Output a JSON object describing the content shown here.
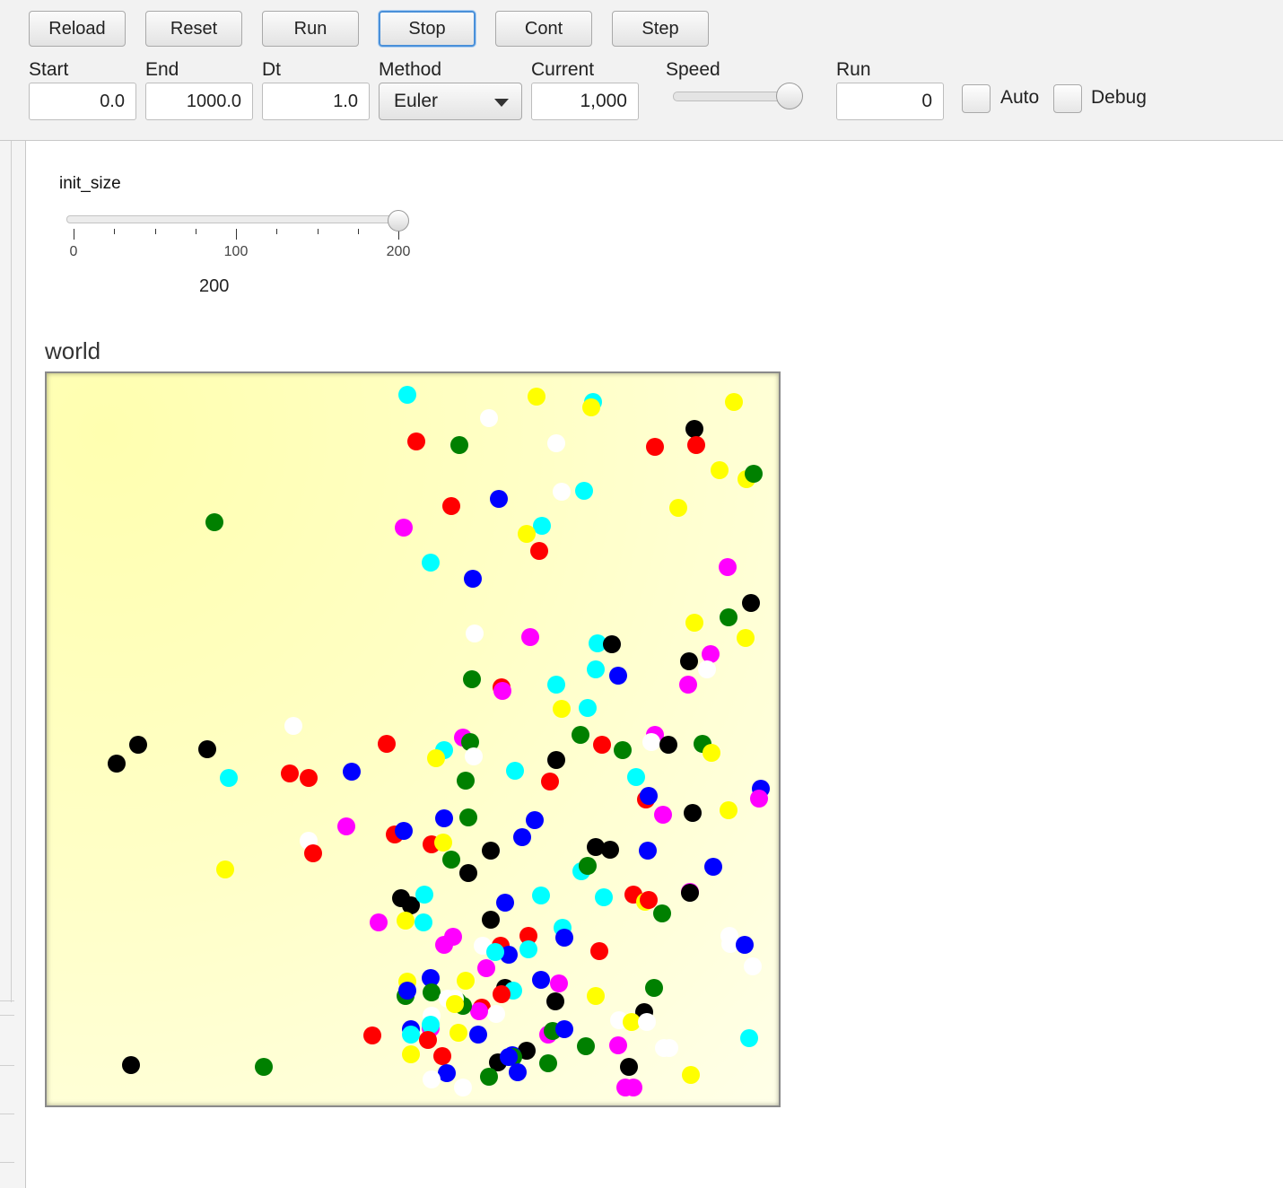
{
  "toolbar": {
    "buttons": [
      "Reload",
      "Reset",
      "Run",
      "Stop",
      "Cont",
      "Step"
    ],
    "labels": {
      "start": "Start",
      "end": "End",
      "dt": "Dt",
      "method": "Method",
      "current": "Current",
      "speed": "Speed",
      "run": "Run"
    },
    "fields": {
      "start": "0.0",
      "end": "1000.0",
      "dt": "1.0",
      "method": "Euler",
      "current": "1,000",
      "run": "0"
    },
    "speed_level": 0.9,
    "checkboxes": {
      "auto": "Auto",
      "debug": "Debug"
    }
  },
  "params": {
    "init_size": {
      "label": "init_size",
      "min": 0,
      "max": 200,
      "value": 200,
      "ticks": [
        "0",
        "100",
        "200"
      ],
      "value_text": "200"
    }
  },
  "world": {
    "title": "world",
    "agent_colors": {
      "c": "#00ffff",
      "y": "#ffff00",
      "w": "#ffffff",
      "r": "#ff0000",
      "g": "#008000",
      "b": "#0000ff",
      "m": "#ff00ff",
      "k": "#000000"
    },
    "agents": [
      [
        "c",
        402,
        24
      ],
      [
        "y",
        546,
        26
      ],
      [
        "c",
        609,
        32
      ],
      [
        "y",
        607,
        38
      ],
      [
        "y",
        766,
        32
      ],
      [
        "w",
        493,
        50
      ],
      [
        "k",
        722,
        62
      ],
      [
        "r",
        412,
        76
      ],
      [
        "g",
        460,
        80
      ],
      [
        "w",
        568,
        78
      ],
      [
        "r",
        678,
        82
      ],
      [
        "r",
        724,
        80
      ],
      [
        "y",
        750,
        108
      ],
      [
        "y",
        780,
        118
      ],
      [
        "g",
        788,
        112
      ],
      [
        "w",
        574,
        132
      ],
      [
        "c",
        599,
        131
      ],
      [
        "b",
        504,
        140
      ],
      [
        "r",
        451,
        148
      ],
      [
        "y",
        704,
        150
      ],
      [
        "g",
        187,
        166
      ],
      [
        "m",
        398,
        172
      ],
      [
        "c",
        552,
        170
      ],
      [
        "y",
        535,
        179
      ],
      [
        "r",
        549,
        198
      ],
      [
        "c",
        428,
        211
      ],
      [
        "b",
        475,
        229
      ],
      [
        "m",
        759,
        216
      ],
      [
        "k",
        785,
        256
      ],
      [
        "g",
        760,
        272
      ],
      [
        "y",
        722,
        278
      ],
      [
        "w",
        477,
        290
      ],
      [
        "m",
        539,
        294
      ],
      [
        "y",
        779,
        295
      ],
      [
        "c",
        614,
        301
      ],
      [
        "k",
        630,
        302
      ],
      [
        "b",
        637,
        337
      ],
      [
        "c",
        612,
        330
      ],
      [
        "m",
        740,
        313
      ],
      [
        "k",
        716,
        321
      ],
      [
        "w",
        736,
        330
      ],
      [
        "g",
        474,
        341
      ],
      [
        "r",
        507,
        350
      ],
      [
        "m",
        508,
        354
      ],
      [
        "c",
        568,
        347
      ],
      [
        "m",
        715,
        347
      ],
      [
        "y",
        574,
        374
      ],
      [
        "c",
        603,
        373
      ],
      [
        "w",
        275,
        393
      ],
      [
        "k",
        102,
        414
      ],
      [
        "k",
        179,
        419
      ],
      [
        "k",
        78,
        435
      ],
      [
        "c",
        203,
        451
      ],
      [
        "r",
        379,
        413
      ],
      [
        "c",
        443,
        420
      ],
      [
        "y",
        434,
        429
      ],
      [
        "m",
        464,
        406
      ],
      [
        "g",
        472,
        411
      ],
      [
        "w",
        476,
        427
      ],
      [
        "g",
        595,
        403
      ],
      [
        "r",
        619,
        414
      ],
      [
        "g",
        642,
        420
      ],
      [
        "m",
        678,
        403
      ],
      [
        "w",
        674,
        411
      ],
      [
        "k",
        693,
        414
      ],
      [
        "g",
        731,
        413
      ],
      [
        "y",
        741,
        423
      ],
      [
        "k",
        568,
        431
      ],
      [
        "c",
        522,
        443
      ],
      [
        "r",
        271,
        446
      ],
      [
        "r",
        292,
        451
      ],
      [
        "b",
        340,
        444
      ],
      [
        "g",
        467,
        454
      ],
      [
        "r",
        561,
        455
      ],
      [
        "c",
        657,
        450
      ],
      [
        "r",
        668,
        475
      ],
      [
        "b",
        671,
        471
      ],
      [
        "m",
        687,
        492
      ],
      [
        "b",
        796,
        463
      ],
      [
        "m",
        794,
        474
      ],
      [
        "k",
        720,
        490
      ],
      [
        "y",
        760,
        487
      ],
      [
        "w",
        292,
        521
      ],
      [
        "m",
        334,
        505
      ],
      [
        "r",
        388,
        514
      ],
      [
        "b",
        398,
        510
      ],
      [
        "r",
        429,
        525
      ],
      [
        "b",
        443,
        496
      ],
      [
        "y",
        442,
        523
      ],
      [
        "g",
        470,
        495
      ],
      [
        "b",
        544,
        498
      ],
      [
        "b",
        530,
        517
      ],
      [
        "k",
        495,
        532
      ],
      [
        "g",
        451,
        542
      ],
      [
        "k",
        470,
        557
      ],
      [
        "k",
        612,
        528
      ],
      [
        "k",
        628,
        531
      ],
      [
        "b",
        670,
        532
      ],
      [
        "c",
        596,
        555
      ],
      [
        "g",
        603,
        549
      ],
      [
        "b",
        743,
        550
      ],
      [
        "r",
        297,
        535
      ],
      [
        "y",
        199,
        553
      ],
      [
        "k",
        395,
        585
      ],
      [
        "k",
        406,
        593
      ],
      [
        "c",
        421,
        581
      ],
      [
        "y",
        400,
        610
      ],
      [
        "m",
        370,
        612
      ],
      [
        "c",
        420,
        612
      ],
      [
        "b",
        511,
        590
      ],
      [
        "c",
        551,
        582
      ],
      [
        "c",
        621,
        584
      ],
      [
        "r",
        654,
        581
      ],
      [
        "y",
        667,
        589
      ],
      [
        "r",
        671,
        587
      ],
      [
        "g",
        686,
        602
      ],
      [
        "m",
        717,
        578
      ],
      [
        "k",
        717,
        579
      ],
      [
        "k",
        495,
        609
      ],
      [
        "w",
        761,
        627
      ],
      [
        "w",
        762,
        636
      ],
      [
        "b",
        778,
        637
      ],
      [
        "w",
        787,
        661
      ],
      [
        "m",
        443,
        637
      ],
      [
        "m",
        453,
        628
      ],
      [
        "r",
        537,
        627
      ],
      [
        "c",
        575,
        618
      ],
      [
        "b",
        577,
        629
      ],
      [
        "c",
        537,
        642
      ],
      [
        "w",
        486,
        638
      ],
      [
        "r",
        506,
        638
      ],
      [
        "b",
        515,
        648
      ],
      [
        "c",
        500,
        645
      ],
      [
        "r",
        616,
        644
      ],
      [
        "m",
        490,
        663
      ],
      [
        "y",
        402,
        678
      ],
      [
        "g",
        400,
        694
      ],
      [
        "b",
        402,
        688
      ],
      [
        "b",
        428,
        674
      ],
      [
        "g",
        429,
        690
      ],
      [
        "y",
        467,
        677
      ],
      [
        "w",
        447,
        697
      ],
      [
        "b",
        551,
        676
      ],
      [
        "m",
        571,
        680
      ],
      [
        "k",
        511,
        685
      ],
      [
        "c",
        520,
        688
      ],
      [
        "r",
        507,
        692
      ],
      [
        "g",
        677,
        685
      ],
      [
        "y",
        612,
        694
      ],
      [
        "k",
        567,
        700
      ],
      [
        "w",
        429,
        716
      ],
      [
        "r",
        485,
        707
      ],
      [
        "w",
        501,
        714
      ],
      [
        "m",
        482,
        711
      ],
      [
        "g",
        464,
        705
      ],
      [
        "g",
        458,
        700
      ],
      [
        "w",
        455,
        697
      ],
      [
        "y",
        455,
        703
      ],
      [
        "k",
        666,
        712
      ],
      [
        "w",
        638,
        721
      ],
      [
        "y",
        652,
        723
      ],
      [
        "w",
        669,
        723
      ],
      [
        "r",
        363,
        738
      ],
      [
        "b",
        406,
        731
      ],
      [
        "m",
        428,
        730
      ],
      [
        "c",
        406,
        737
      ],
      [
        "c",
        428,
        726
      ],
      [
        "r",
        425,
        743
      ],
      [
        "y",
        459,
        735
      ],
      [
        "b",
        481,
        737
      ],
      [
        "m",
        559,
        737
      ],
      [
        "g",
        564,
        733
      ],
      [
        "b",
        577,
        731
      ],
      [
        "w",
        688,
        752
      ],
      [
        "w",
        694,
        752
      ],
      [
        "c",
        783,
        741
      ],
      [
        "y",
        406,
        759
      ],
      [
        "r",
        441,
        761
      ],
      [
        "g",
        601,
        750
      ],
      [
        "m",
        637,
        749
      ],
      [
        "k",
        535,
        755
      ],
      [
        "b",
        519,
        760
      ],
      [
        "g",
        520,
        762
      ],
      [
        "k",
        503,
        768
      ],
      [
        "b",
        515,
        762
      ],
      [
        "g",
        559,
        769
      ],
      [
        "b",
        525,
        779
      ],
      [
        "k",
        649,
        773
      ],
      [
        "y",
        718,
        782
      ],
      [
        "g",
        493,
        784
      ],
      [
        "b",
        446,
        780
      ],
      [
        "k",
        94,
        771
      ],
      [
        "g",
        242,
        773
      ],
      [
        "w",
        429,
        787
      ],
      [
        "w",
        464,
        796
      ],
      [
        "m",
        645,
        796
      ],
      [
        "m",
        654,
        796
      ]
    ]
  }
}
